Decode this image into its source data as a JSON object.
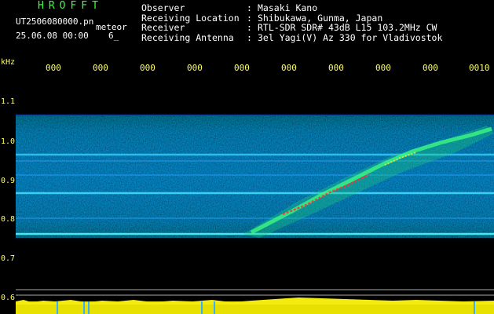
{
  "header": {
    "title": "HROFFT",
    "file_name": "UT2506080000.pn",
    "meteor_label": "meteor",
    "date_time": "25.06.08 00:00",
    "count": "6_"
  },
  "info": [
    {
      "key": "Observer",
      "sep": ":",
      "value": "Masaki Kano"
    },
    {
      "key": "Receiving Location",
      "sep": ":",
      "value": "Shibukawa, Gunma, Japan"
    },
    {
      "key": "Receiver",
      "sep": ":",
      "value": "RTL-SDR SDR# 43dB L15 103.2MHz CW"
    },
    {
      "key": "Receiving Antenna",
      "sep": ":",
      "value": "3el Yagi(V) Az 330 for Vladivostok"
    }
  ],
  "axis": {
    "unit": "kHz",
    "time_labels": [
      "000",
      "000",
      "000",
      "000",
      "000",
      "000",
      "000",
      "000",
      "000",
      "0010"
    ],
    "freq_labels": [
      "1.1",
      "1.0",
      "0.9",
      "0.8",
      "0.7",
      "0.6"
    ]
  },
  "colors": {
    "title": "#3cff3c",
    "axis_labels": "#ffff66",
    "text": "#ffffff",
    "background": "#000000"
  }
}
